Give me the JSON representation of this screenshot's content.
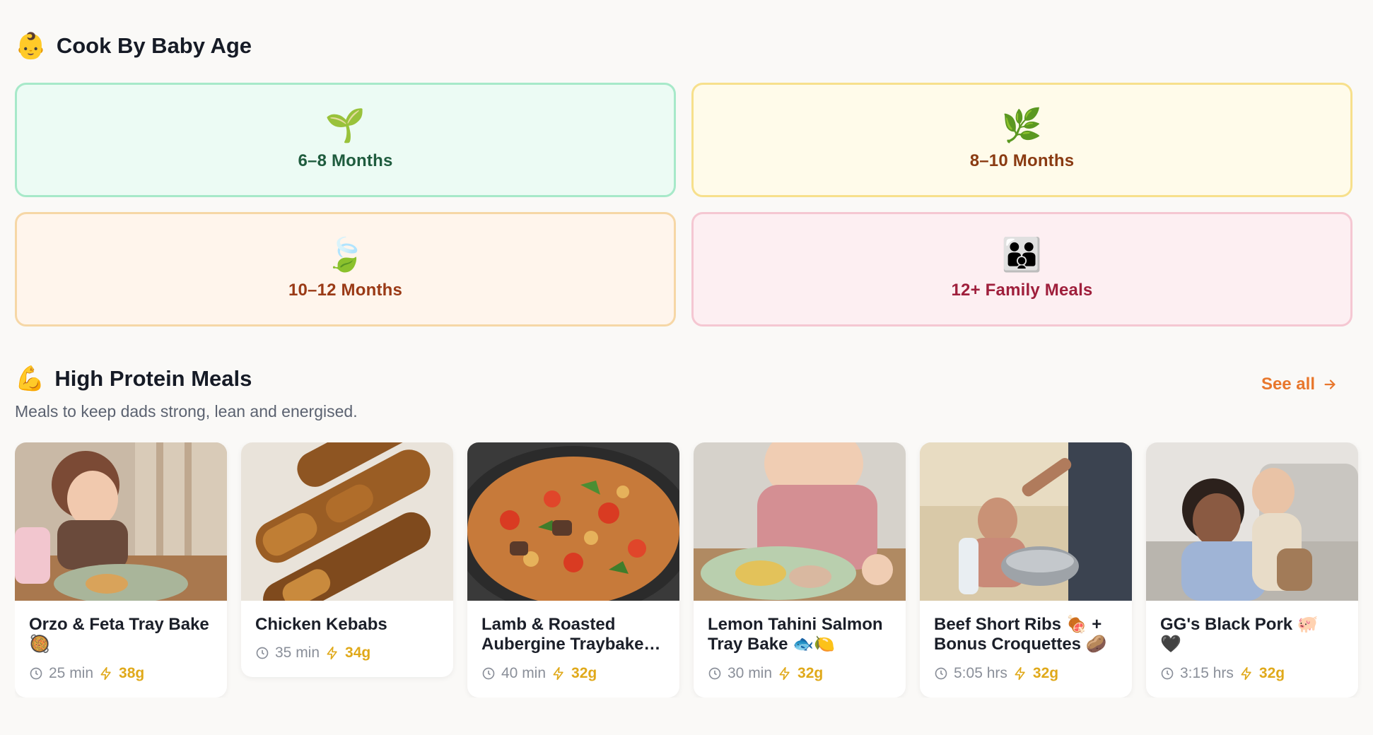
{
  "age_section": {
    "icon": "baby-face-icon",
    "icon_glyph": "👶",
    "title": "Cook By Baby Age",
    "cards": [
      {
        "glyph": "🌱",
        "icon": "seedling-icon",
        "label": "6–8 Months",
        "bg": "#ecfbf4",
        "border": "#a7e9c9",
        "color": "#1f5c3e"
      },
      {
        "glyph": "🌿",
        "icon": "herb-icon",
        "label": "8–10 Months",
        "bg": "#fffbea",
        "border": "#f7e08c",
        "color": "#8a3b12"
      },
      {
        "glyph": "🍃",
        "icon": "leaves-icon",
        "label": "10–12 Months",
        "bg": "#fff5ec",
        "border": "#f6d7a6",
        "color": "#9a3a16"
      },
      {
        "glyph": "👪",
        "icon": "family-icon",
        "label": "12+ Family Meals",
        "bg": "#fdeff2",
        "border": "#f5c7d2",
        "color": "#9f1f3c"
      }
    ]
  },
  "protein_section": {
    "icon": "flexed-biceps-icon",
    "icon_glyph": "💪",
    "title": "High Protein Meals",
    "subtitle": "Meals to keep dads strong, lean and energised.",
    "see_all_label": "See all",
    "meals": [
      {
        "title": "Orzo & Feta Tray Bake 🥘",
        "time": "25 min",
        "protein": "38g"
      },
      {
        "title": "Chicken Kebabs",
        "time": "35 min",
        "protein": "34g"
      },
      {
        "title": "Lamb & Roasted Aubergine Traybake with Chickpeas",
        "time": "40 min",
        "protein": "32g"
      },
      {
        "title": "Lemon Tahini Salmon Tray Bake 🐟🍋",
        "time": "30 min",
        "protein": "32g"
      },
      {
        "title": "Beef Short Ribs 🍖 + Bonus Croquettes 🥔",
        "time": "5:05 hrs",
        "protein": "32g"
      },
      {
        "title": "GG's Black Pork 🐖 🖤",
        "time": "3:15 hrs",
        "protein": "32g"
      }
    ]
  },
  "colors": {
    "accent": "#e8772c",
    "protein": "#e0a91a",
    "background": "#faf9f7"
  }
}
